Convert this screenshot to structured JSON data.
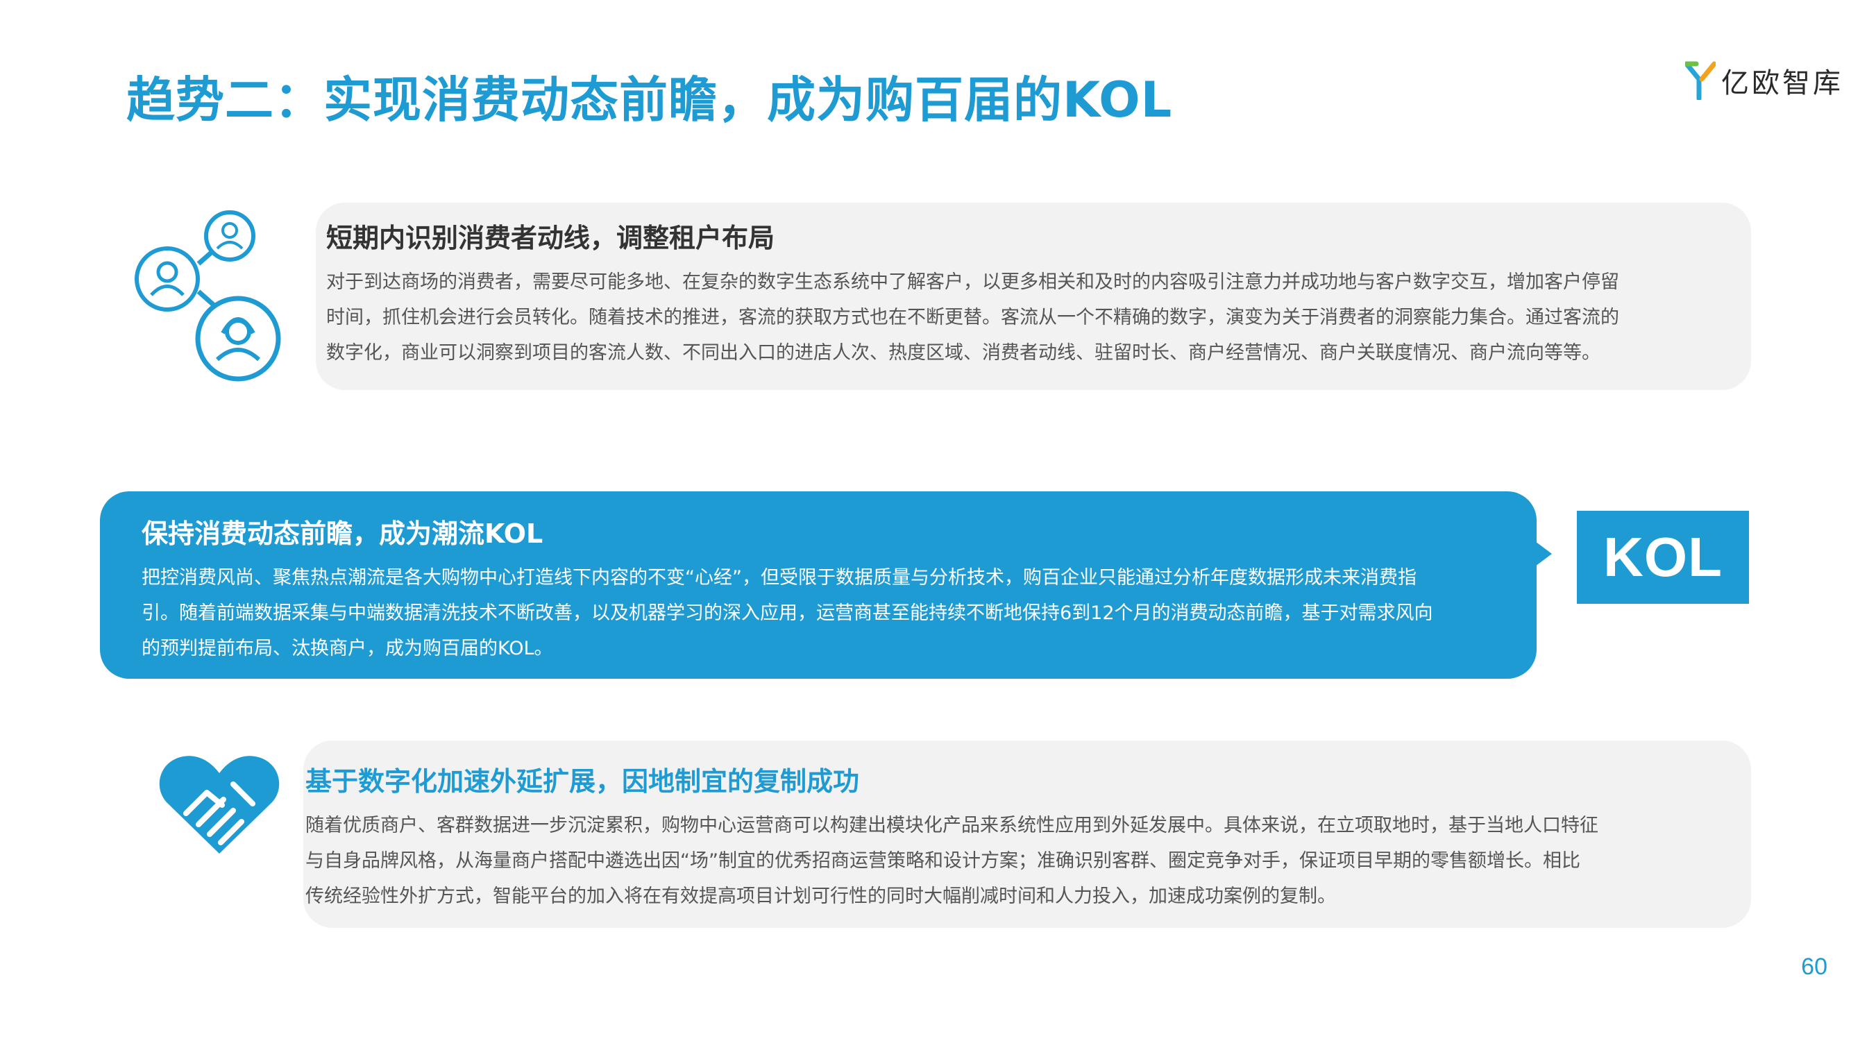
{
  "page": {
    "title": "趋势二：实现消费动态前瞻，成为购百届的KOL",
    "logo_text": "亿欧智库",
    "page_number": "60"
  },
  "colors": {
    "accent": "#1f9bd3",
    "panel_gray": "#f2f2f2",
    "body_text": "#555555"
  },
  "sections": [
    {
      "title": "短期内识别消费者动线，调整租户布局",
      "lines": [
        "对于到达商场的消费者，需要尽可能多地、在复杂的数字生态系统中了解客户，以更多相关和及时的内容吸引注意力并成功地与客户数字交互，增加客户停留",
        "时间，抓住机会进行会员转化。随着技术的推进，客流的获取方式也在不断更替。客流从一个不精确的数字，演变为关于消费者的洞察能力集合。通过客流的",
        "数字化，商业可以洞察到项目的客流人数、不同出入口的进店人次、热度区域、消费者动线、驻留时长、商户经营情况、商户关联度情况、商户流向等等。"
      ],
      "icon": "people-network-icon"
    },
    {
      "title": "保持消费动态前瞻，成为潮流KOL",
      "lines": [
        "把控消费风尚、聚焦热点潮流是各大购物中心打造线下内容的不变“心经”，但受限于数据质量与分析技术，购百企业只能通过分析年度数据形成未来消费指",
        "引。随着前端数据采集与中端数据清洗技术不断改善，以及机器学习的深入应用，运营商甚至能持续不断地保持6到12个月的消费动态前瞻，基于对需求风向",
        "的预判提前布局、汰换商户，成为购百届的KOL。"
      ],
      "badge": "KOL"
    },
    {
      "title": "基于数字化加速外延扩展，因地制宜的复制成功",
      "lines": [
        "随着优质商户、客群数据进一步沉淀累积，购物中心运营商可以构建出模块化产品来系统性应用到外延发展中。具体来说，在立项取地时，基于当地人口特征",
        "与自身品牌风格，从海量商户搭配中遴选出因“场”制宜的优秀招商运营策略和设计方案；准确识别客群、圈定竞争对手，保证项目早期的零售额增长。相比",
        "传统经验性外扩方式，智能平台的加入将在有效提高项目计划可行性的同时大幅削减时间和人力投入，加速成功案例的复制。"
      ],
      "icon": "handshake-heart-icon"
    }
  ]
}
